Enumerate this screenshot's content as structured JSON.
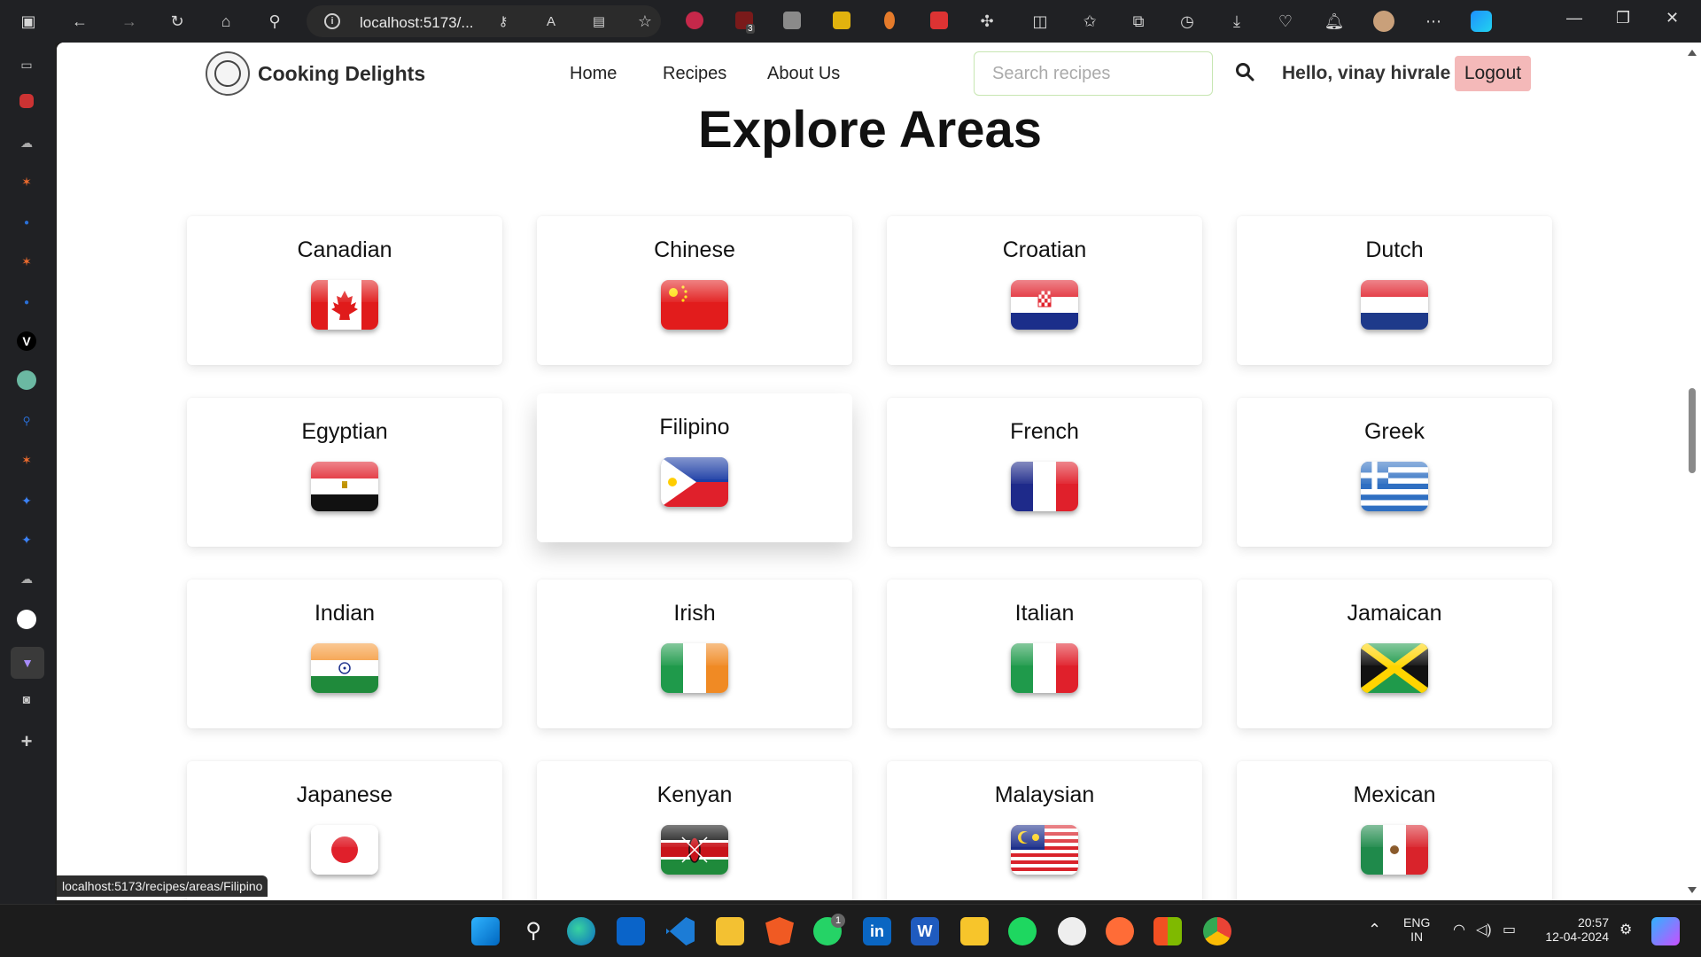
{
  "browser": {
    "url": "localhost:5173/...",
    "status_link": "localhost:5173/recipes/areas/Filipino",
    "extension_badge": "3"
  },
  "navbar": {
    "brand": "Cooking Delights",
    "links": [
      "Home",
      "Recipes",
      "About Us"
    ],
    "search_placeholder": "Search recipes",
    "search_value": "",
    "greeting": "Hello, vinay hivrale",
    "logout_label": "Logout"
  },
  "page": {
    "title": "Explore Areas",
    "areas": [
      {
        "name": "Canadian",
        "flag": "canada-flag"
      },
      {
        "name": "Chinese",
        "flag": "china-flag"
      },
      {
        "name": "Croatian",
        "flag": "croatia-flag"
      },
      {
        "name": "Dutch",
        "flag": "netherlands-flag"
      },
      {
        "name": "Egyptian",
        "flag": "egypt-flag"
      },
      {
        "name": "Filipino",
        "flag": "philippines-flag",
        "hovered": true
      },
      {
        "name": "French",
        "flag": "france-flag"
      },
      {
        "name": "Greek",
        "flag": "greece-flag"
      },
      {
        "name": "Indian",
        "flag": "india-flag"
      },
      {
        "name": "Irish",
        "flag": "ireland-flag"
      },
      {
        "name": "Italian",
        "flag": "italy-flag"
      },
      {
        "name": "Jamaican",
        "flag": "jamaica-flag"
      },
      {
        "name": "Japanese",
        "flag": "japan-flag"
      },
      {
        "name": "Kenyan",
        "flag": "kenya-flag"
      },
      {
        "name": "Malaysian",
        "flag": "malaysia-flag"
      },
      {
        "name": "Mexican",
        "flag": "mexico-flag"
      }
    ]
  },
  "taskbar": {
    "language": "ENG",
    "region": "IN",
    "time": "20:57",
    "date": "12-04-2024",
    "whatsapp_badge": "1"
  },
  "colors": {
    "logout_bg": "#f4b9b9",
    "search_border": "#c7e6b2"
  }
}
